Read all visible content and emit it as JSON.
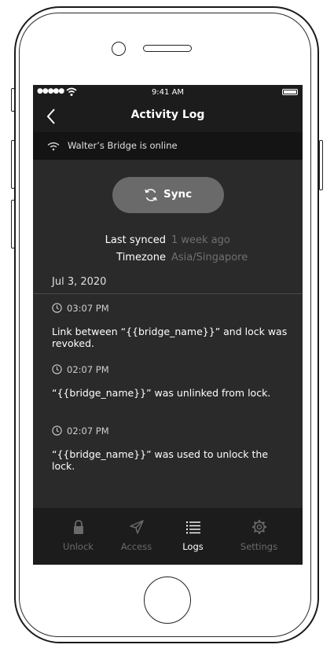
{
  "status_bar": {
    "signal": "●●●●●",
    "time": "9:41 AM"
  },
  "nav": {
    "title": "Activity Log"
  },
  "banner": {
    "text": "Walter’s Bridge is online"
  },
  "sync": {
    "label": "Sync"
  },
  "meta": {
    "last_synced_label": "Last synced",
    "last_synced_value": "1 week ago",
    "timezone_label": "Timezone",
    "timezone_value": "Asia/Singapore"
  },
  "date_header": "Jul 3, 2020",
  "entries": [
    {
      "time": "03:07 PM",
      "text": "Link between “{{bridge_name}}” and lock was revoked."
    },
    {
      "time": "02:07 PM",
      "text": "“{{bridge_name}}” was unlinked from lock."
    },
    {
      "time": "02:07 PM",
      "text": "“{{bridge_name}}” was used to unlock the lock."
    }
  ],
  "tabs": [
    {
      "label": "Unlock",
      "icon": "lock-icon",
      "active": false
    },
    {
      "label": "Access",
      "icon": "send-icon",
      "active": false
    },
    {
      "label": "Logs",
      "icon": "list-icon",
      "active": true
    },
    {
      "label": "Settings",
      "icon": "gear-icon",
      "active": false
    }
  ]
}
